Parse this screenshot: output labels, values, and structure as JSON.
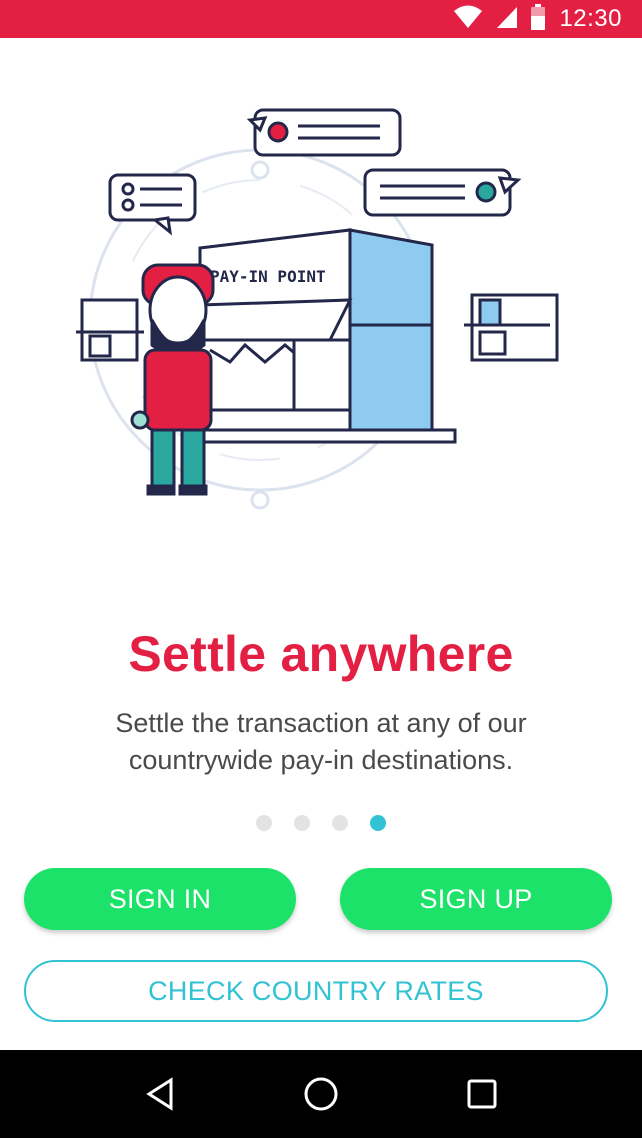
{
  "status_bar": {
    "time": "12:30",
    "background_color": "#e41f44",
    "icons": [
      "wifi-icon",
      "cellular-signal-icon",
      "battery-icon"
    ]
  },
  "illustration": {
    "sign_text": "PAY-IN POINT",
    "icons": [
      "store-illustration",
      "person-illustration",
      "chat-bubble-icon"
    ]
  },
  "onboarding": {
    "title": "Settle anywhere",
    "description_line1": "Settle the transaction at any of our",
    "description_line2": "countrywide pay-in destinations.",
    "page_count": 4,
    "active_page": 4,
    "title_color": "#e41f44",
    "indicator_active_color": "#31c2d4"
  },
  "actions": {
    "sign_in_label": "SIGN IN",
    "sign_up_label": "SIGN UP",
    "check_rates_label": "CHECK COUNTRY RATES",
    "primary_color": "#1de26a",
    "outline_color": "#31c2d4"
  },
  "nav_bar": {
    "icons": [
      "back-icon",
      "home-icon",
      "recents-icon"
    ]
  }
}
